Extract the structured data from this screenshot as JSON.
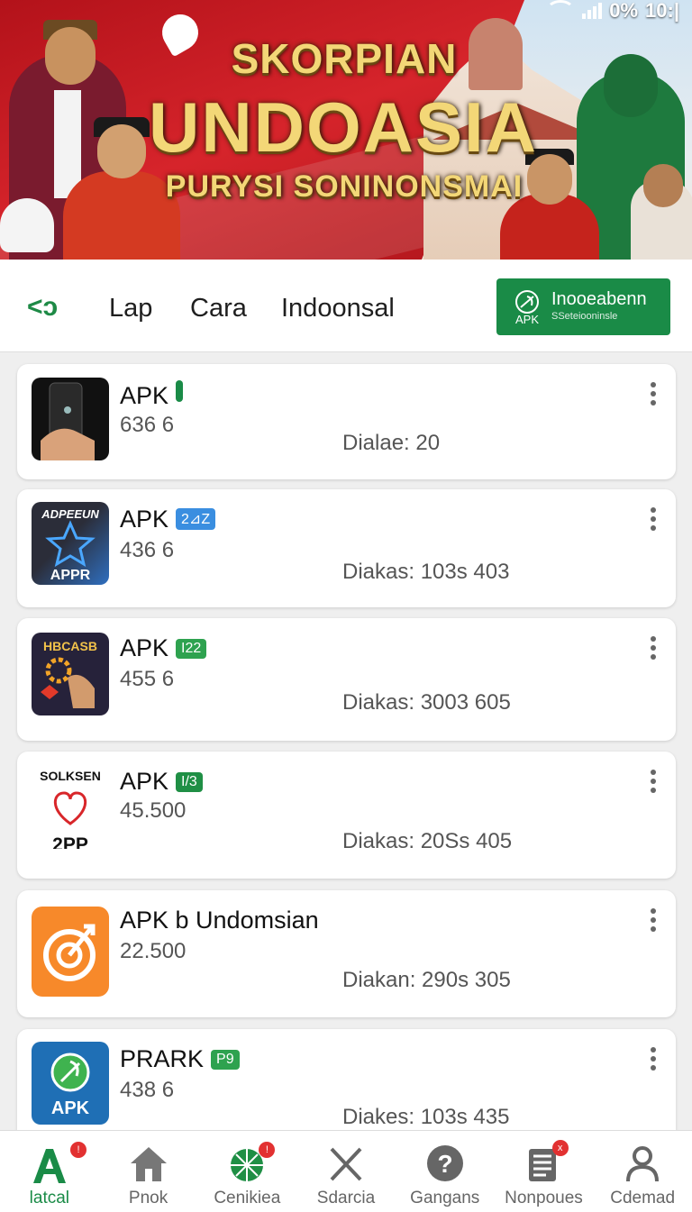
{
  "status_bar": {
    "battery": "0%",
    "time": "10:|"
  },
  "banner": {
    "line1": "SKORPIAN",
    "line2": "UNDOASIA",
    "line3": "PURYSI SONINONSMAI"
  },
  "toolbar": {
    "tabs": [
      "Lap",
      "Cara",
      "Indoonsal"
    ],
    "promo": {
      "title": "Inooeabenn",
      "subtitle": "SSeteiooninsle",
      "logo_text": "APK"
    }
  },
  "apps": [
    {
      "name": "APK",
      "badge": "",
      "badge_color": "#1a8b47",
      "version": "636 6",
      "downloads": "Dialae: 20",
      "icon": "phone-hand-icon"
    },
    {
      "name": "APK",
      "badge": "2⊿Z",
      "badge_color": "#3a8ee0",
      "version": "436 6",
      "downloads": "Diakas: 103s 403",
      "icon": "star-appr-icon",
      "icon_text_top": "ADPEEUN",
      "icon_text_bottom": "APPR"
    },
    {
      "name": "APK",
      "badge": "I22",
      "badge_color": "#2ea24f",
      "version": "455 6",
      "downloads": "Diakas: 3003 605",
      "icon": "gear-hand-icon",
      "icon_text_top": "HBCASB"
    },
    {
      "name": "APK",
      "badge": "I/3",
      "badge_color": "#1f8f45",
      "version": "45.500",
      "downloads": "Diakas: 20Ss 405",
      "icon": "heart-icon",
      "icon_text_top": "SOLKSEN",
      "icon_text_bottom": "2PP"
    },
    {
      "name": "APK b Undomsian",
      "badge": "",
      "badge_color": "",
      "version": "22.500",
      "downloads": "Diakan: 290s 305",
      "icon": "target-arrow-icon"
    },
    {
      "name": "PRARK",
      "badge": "P9",
      "badge_color": "#2ea24f",
      "version": "438 6",
      "downloads": "Diakes: 103s 435",
      "icon": "apk-leaf-icon",
      "icon_text_bottom": "APK"
    }
  ],
  "bottom_nav": [
    {
      "label": "latcal",
      "icon": "apk-logo-icon",
      "active": true,
      "badge": "!"
    },
    {
      "label": "Pnok",
      "icon": "home-icon",
      "active": false
    },
    {
      "label": "Cenikiea",
      "icon": "globe-icon",
      "active": false,
      "badge": "!"
    },
    {
      "label": "Sdarcia",
      "icon": "close-icon",
      "active": false
    },
    {
      "label": "Gangans",
      "icon": "help-icon",
      "active": false
    },
    {
      "label": "Nonpoues",
      "icon": "news-icon",
      "active": false,
      "badge": "x"
    },
    {
      "label": "Cdemad",
      "icon": "user-icon",
      "active": false
    }
  ],
  "colors": {
    "accent": "#1a8b47",
    "banner_red": "#c8121a",
    "gold": "#f3d777"
  }
}
